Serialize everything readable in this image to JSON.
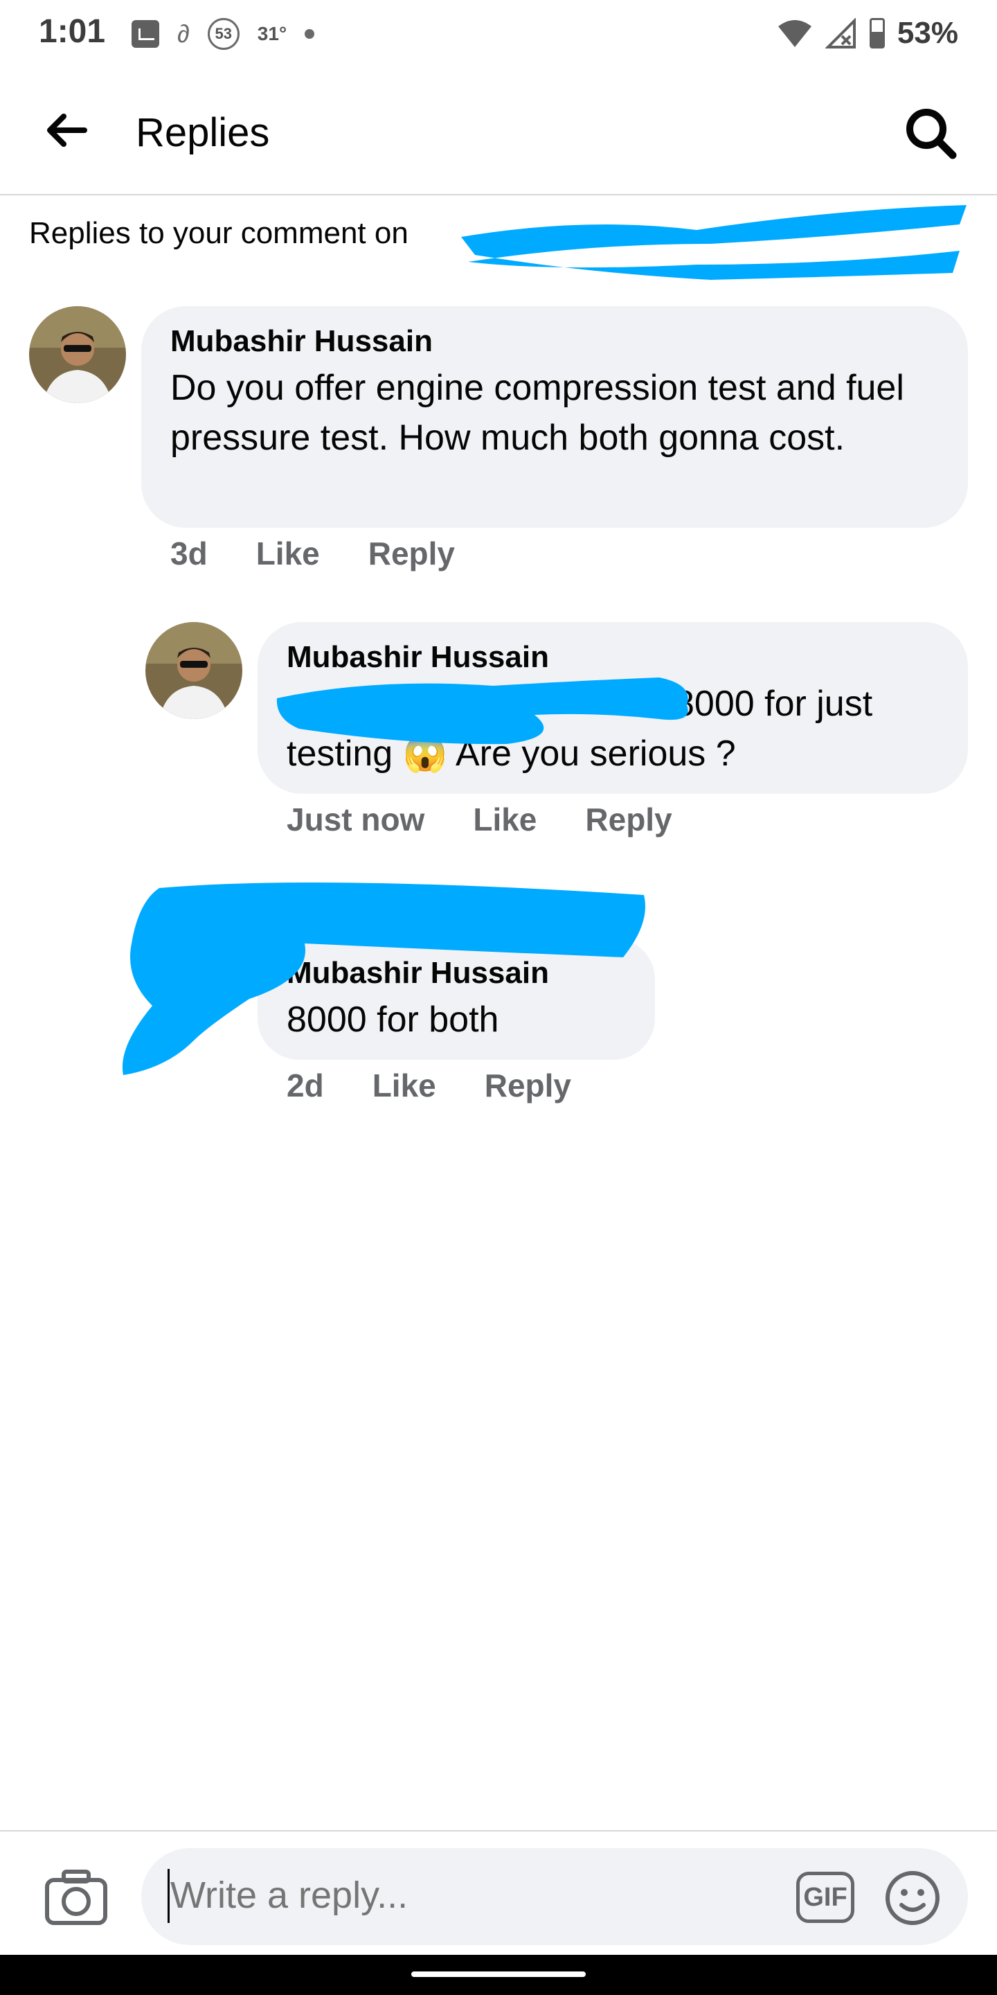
{
  "status_bar": {
    "time": "1:01",
    "badge_number": "53",
    "temperature": "31°",
    "battery": "53%"
  },
  "app_bar": {
    "title": "Replies"
  },
  "subheader": "Replies to your comment on",
  "comments": [
    {
      "author": "Mubashir Hussain",
      "text": "Do you offer engine compression test and fuel pressure test. How much both gonna cost.",
      "time": "3d",
      "like": "Like",
      "reply": "Reply"
    },
    {
      "author": "Mubashir Hussain",
      "text_before": "8000 for just",
      "text_line2_start": "testing",
      "emoji": "😱",
      "text_line2_end": "Are you serious ?",
      "time": "Just now",
      "like": "Like",
      "reply": "Reply"
    },
    {
      "author": "Mubashir Hussain",
      "text": "8000 for both",
      "time": "2d",
      "like": "Like",
      "reply": "Reply"
    }
  ],
  "composer": {
    "placeholder": "Write a reply...",
    "gif_label": "GIF"
  },
  "colors": {
    "bubble": "#f0f2f5",
    "meta_text": "#65676b",
    "redaction": "#00aaff"
  }
}
